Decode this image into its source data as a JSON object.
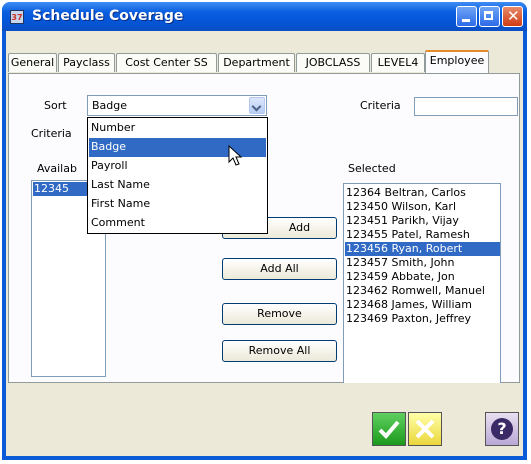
{
  "window": {
    "title": "Schedule Coverage",
    "icon_text": "37"
  },
  "tabs": [
    {
      "label": "General"
    },
    {
      "label": "Payclass"
    },
    {
      "label": "Cost Center SS"
    },
    {
      "label": "Department"
    },
    {
      "label": "JOBCLASS"
    },
    {
      "label": "LEVEL4"
    },
    {
      "label": "Employee"
    }
  ],
  "sort": {
    "label": "Sort",
    "value": "Badge"
  },
  "criteria": {
    "label": "Criteria",
    "left_label": "Criteria",
    "value": ""
  },
  "sort_options": [
    "Number",
    "Badge",
    "Payroll",
    "Last Name",
    "First Name",
    "Comment"
  ],
  "available": {
    "label": "Availab",
    "items": [
      "12345"
    ]
  },
  "selected": {
    "label": "Selected",
    "items": [
      "12364 Beltran, Carlos",
      "123450 Wilson, Karl",
      "123451 Parikh, Vijay",
      "123455 Patel, Ramesh",
      "123456 Ryan, Robert",
      "123457 Smith, John",
      "123459 Abbate, Jon",
      "123462 Romwell, Manuel",
      "123468 James, William",
      "123469 Paxton, Jeffrey"
    ]
  },
  "buttons": {
    "add": "Add",
    "add_all": "Add All",
    "remove": "Remove",
    "remove_all": "Remove All"
  },
  "footer": {
    "help_symbol": "?"
  },
  "colors": {
    "accent": "#316ac5",
    "tab_highlight": "#e68b2c",
    "ok": "#1c9a1c",
    "cancel": "#ead63a"
  }
}
